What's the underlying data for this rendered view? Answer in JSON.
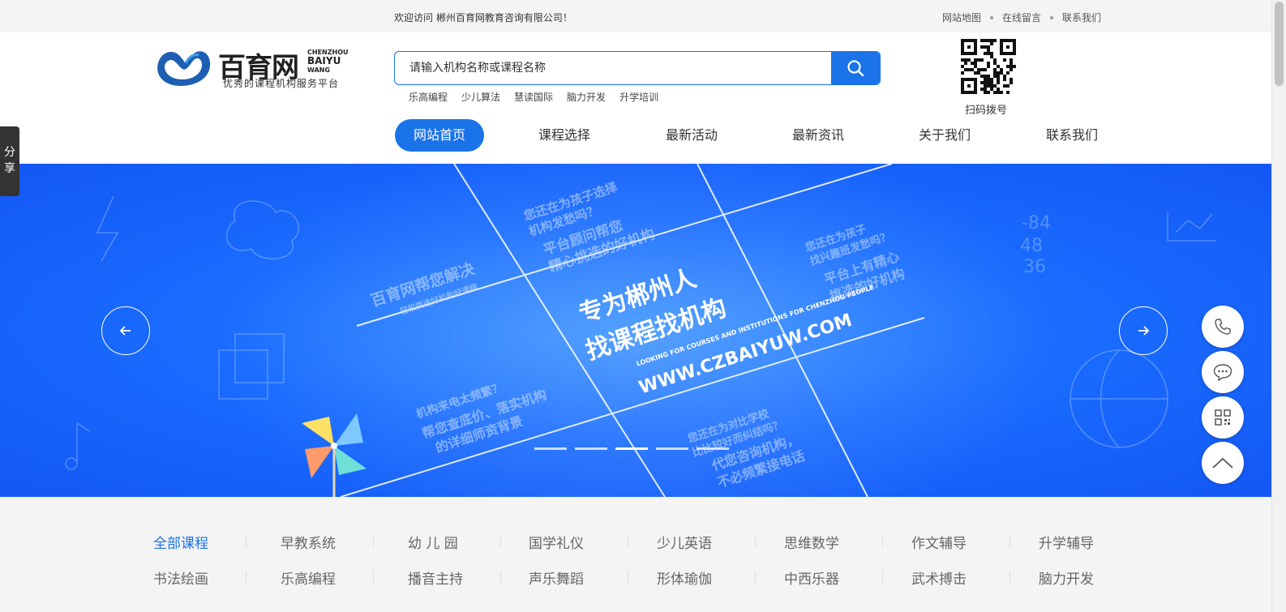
{
  "topbar": {
    "welcome": "欢迎访问 郴州百育网教育咨询有限公司！",
    "links": [
      "网站地图",
      "在线留言",
      "联系我们"
    ]
  },
  "logo": {
    "name_cn": "百育网",
    "name_en": [
      "CHENZHOU",
      "BAIYU",
      "WANG"
    ],
    "slogan": "优秀的课程机构服务平台"
  },
  "search": {
    "placeholder": "请输入机构名称或课程名称",
    "hotwords": [
      "乐高编程",
      "少儿算法",
      "慧读国际",
      "脑力开发",
      "升学培训"
    ]
  },
  "qr": {
    "label": "扫码拨号"
  },
  "nav": {
    "items": [
      "网站首页",
      "课程选择",
      "最新活动",
      "最新资讯",
      "关于我们",
      "联系我们"
    ],
    "active_index": 0
  },
  "banner": {
    "slogan_line1": "专为郴州人",
    "slogan_line2": "找课程找机构",
    "slogan_en": "LOOKING FOR COURSES AND INSTITUTIONS FOR CHENZHOU PEOPLE",
    "url": "WWW.CZBAIYUW.COM",
    "tile_top": [
      "您还在为孩子选择",
      "机构发愁吗？",
      "平台顾问帮您",
      "精心挑选的好机构"
    ],
    "tile_left": [
      "百育网帮您解决",
      "轻松挑选好机构好课程"
    ],
    "tile_right": [
      "您还在为孩子",
      "找兴趣班发愁吗？",
      "平台上有精心",
      "挑选的好机构"
    ],
    "tile_bottom_left": [
      "机构来电太频繁？",
      "帮您查底价、落实机构",
      "的详细师资背景"
    ],
    "tile_bottom_right": [
      "您还在为对比学校",
      "比比较好而纠结吗？",
      "代您咨询机构，",
      "不必频繁接电话"
    ],
    "slide_count": 5,
    "active_slide": 2
  },
  "share": {
    "label": "分享"
  },
  "float_icons": [
    "phone-icon",
    "chat-icon",
    "qrcode-icon",
    "back-to-top-icon"
  ],
  "categories": {
    "row1": [
      "全部课程",
      "早教系统",
      "幼 儿 园",
      "国学礼仪",
      "少儿英语",
      "思维数学",
      "作文辅导",
      "升学辅导"
    ],
    "row2": [
      "书法绘画",
      "乐高编程",
      "播音主持",
      "声乐舞蹈",
      "形体瑜伽",
      "中西乐器",
      "武术搏击",
      "脑力开发"
    ],
    "active": "全部课程"
  },
  "colors": {
    "accent": "#1a73e8",
    "banner": "#1a6dff"
  }
}
